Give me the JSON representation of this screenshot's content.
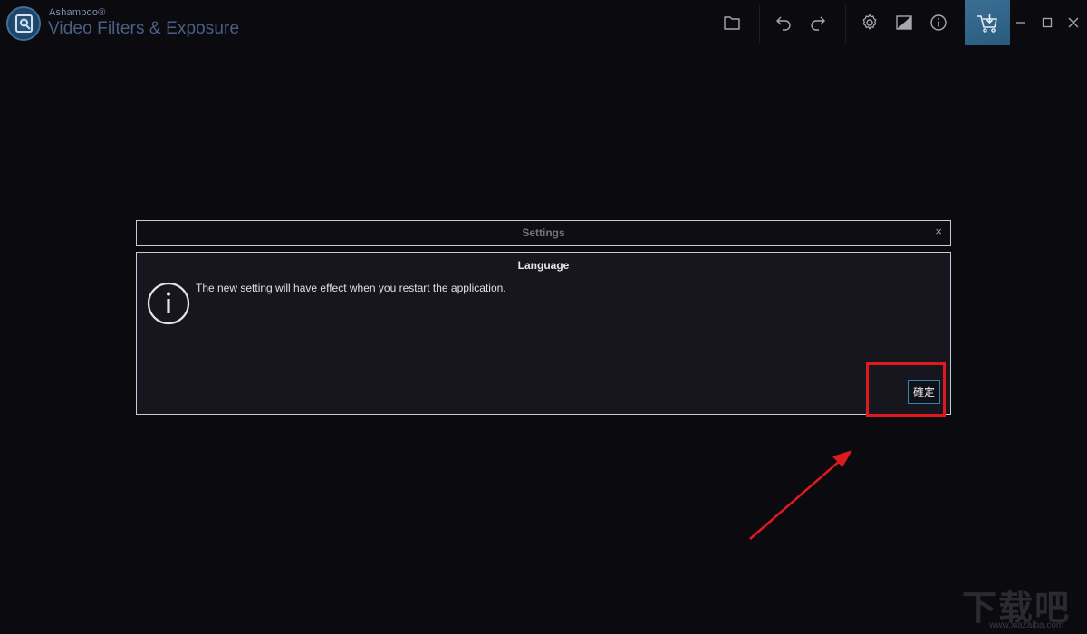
{
  "app": {
    "brand": "Ashampoo®",
    "title": "Video Filters & Exposure"
  },
  "toolbar": {
    "icons": [
      "folder-icon",
      "undo-icon",
      "redo-icon",
      "gear-icon",
      "compare-icon",
      "info-icon"
    ],
    "cart_icon": "cart-download-icon"
  },
  "window_controls": [
    "minimize-icon",
    "maximize-icon",
    "close-icon"
  ],
  "dialog": {
    "title": "Settings",
    "close_label": "×",
    "heading": "Language",
    "message": "The new setting will have effect when you restart the application.",
    "ok_label": "確定",
    "ok_border_color": "#2f86ad"
  },
  "annotation": {
    "color": "#dd1b1f"
  },
  "watermark": {
    "chinese": "下载吧",
    "url": "www.xiazaiba.com"
  }
}
